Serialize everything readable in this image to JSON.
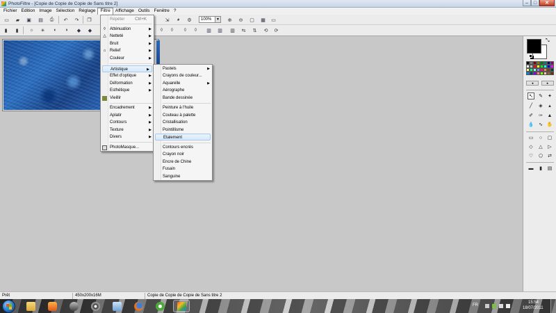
{
  "window": {
    "title": "PhotoFiltre - [Copie de Copie de Copie de Sans titre 2]",
    "minimize_label": "–",
    "maximize_label": "□",
    "close_label": "✕"
  },
  "menubar": {
    "items": [
      "Fichier",
      "Edition",
      "Image",
      "Sélection",
      "Réglage",
      "Filtre",
      "Affichage",
      "Outils",
      "Fenêtre",
      "?"
    ]
  },
  "toolbar": {
    "zoom_value": "100%"
  },
  "filtre_menu": {
    "repeat": {
      "label": "Répéter",
      "shortcut": "Ctrl+K"
    },
    "group1": [
      "Atténuation",
      "Netteté",
      "Bruit",
      "Relief",
      "Couleur"
    ],
    "group2": [
      "Artistique",
      "Effet d'optique",
      "Déformation",
      "Esthétique",
      "Vieillir"
    ],
    "group3": [
      "Encadrement",
      "Aplatir",
      "Contours",
      "Texture",
      "Divers"
    ],
    "photomasque": "PhotoMasque..."
  },
  "artistique_submenu": {
    "group1": [
      "Pastels",
      "Crayons de couleur...",
      "Aquarelle",
      "Aérographe",
      "Bande dessinée"
    ],
    "group2": [
      "Peinture à l'huile",
      "Couteau à palette",
      "Cristallisation",
      "Pointillisme",
      "Etalement"
    ],
    "group3": [
      "Contours encrés",
      "Crayon noir",
      "Encre de Chine",
      "Fusain",
      "Sanguine"
    ],
    "highlighted": "Etalement"
  },
  "statusbar": {
    "status": "Prêt",
    "image_info": "450x200x16M",
    "doc_name": "Copie de Copie de Copie de Sans titre 2"
  },
  "taskbar": {
    "language": "FR",
    "time": "15:54",
    "date": "18/07/2011"
  },
  "colors": {
    "foreground": "#000000",
    "background": "#ffffff",
    "menu_highlight": "#d7e8f9",
    "workspace": "#c8c8c8"
  },
  "palette": [
    "#000000",
    "#808080",
    "#800000",
    "#808000",
    "#008000",
    "#008080",
    "#000080",
    "#800080",
    "#ffffff",
    "#c0c0c0",
    "#ff0000",
    "#ffff00",
    "#00ff00",
    "#00ffff",
    "#0000ff",
    "#ff00ff",
    "#ffff80",
    "#00ff80",
    "#80ffff",
    "#8080ff",
    "#ff0080",
    "#ff8040",
    "#804000",
    "#004040",
    "#0080ff",
    "#004080",
    "#8000ff",
    "#ff8080",
    "#80ff00",
    "#ffcc99",
    "#996633",
    "#663300"
  ]
}
